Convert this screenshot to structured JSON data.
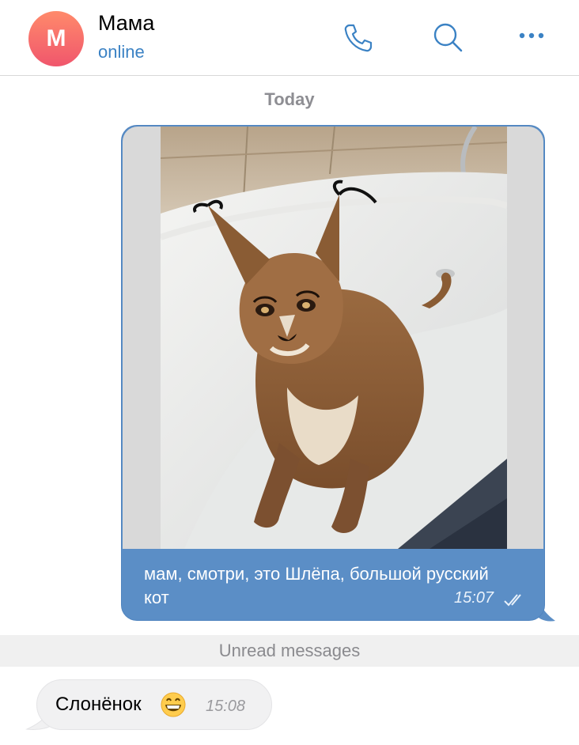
{
  "header": {
    "avatar_letter": "M",
    "contact_name": "Мама",
    "status": "online",
    "icons": [
      "phone-icon",
      "search-icon",
      "more-icon"
    ],
    "accent_color": "#3b82c4"
  },
  "chat": {
    "date_separator": "Today",
    "outgoing": {
      "image": "caracal-in-bathtub-photo",
      "text": "мам, смотри, это Шлёпа, большой русский кот",
      "time": "15:07",
      "status_icon": "double-check-icon",
      "bubble_color": "#5b8ec6"
    },
    "unread_label": "Unread messages",
    "incoming": {
      "text": "Слонёнок",
      "emoji": "grinning-face-emoji",
      "time": "15:08"
    }
  }
}
